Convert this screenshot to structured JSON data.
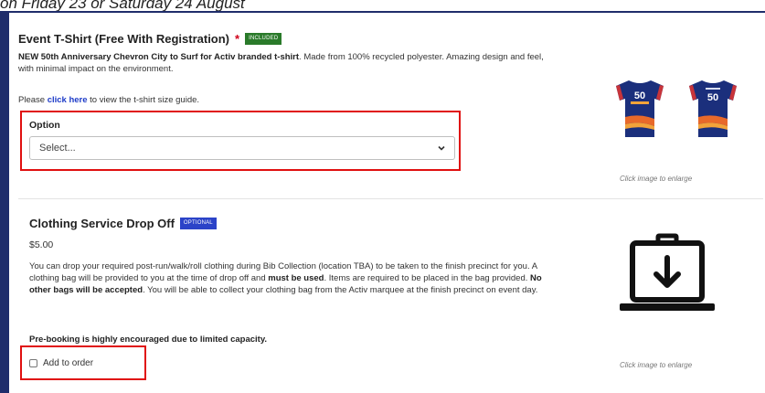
{
  "page": {
    "top_caption": "on Friday 23 or Saturday 24 August"
  },
  "tshirt": {
    "title": "Event T-Shirt (Free With Registration)",
    "required_marker": "*",
    "badge": "INCLUDED",
    "desc_bold": "NEW 50th Anniversary Chevron City to Surf for Activ branded t-shirt",
    "desc_rest": ". Made from 100% recycled polyester. Amazing design and feel, with minimal impact on the environment.",
    "guide_prefix": "Please ",
    "guide_link": "click here",
    "guide_suffix": " to view the t-shirt size guide.",
    "option_label": "Option",
    "select_value": "Select...",
    "enlarge_text": "Click image to enlarge",
    "shirt_mark": "50"
  },
  "clothing": {
    "title": "Clothing Service Drop Off",
    "badge": "OPTIONAL",
    "price": "$5.00",
    "desc_1": "You can drop your required post-run/walk/roll clothing during Bib Collection (location TBA) to be taken to the finish precinct for you. A clothing bag will be provided to you at the time of drop off and ",
    "desc_bold_1": "must be used",
    "desc_2": ". Items are required to be placed in the bag provided. ",
    "desc_bold_2": "No other bags will be accepted",
    "desc_3": ". You will be able to collect your clothing bag from the Activ marquee at the finish precinct on event day.",
    "prebook_note": "Pre-booking is highly encouraged due to limited capacity.",
    "checkbox_label": "Add to order",
    "enlarge_text": "Click image to enlarge"
  },
  "colors": {
    "frame": "#1f2d6b",
    "highlight": "#e01010",
    "link": "#1e3cc8",
    "badge_included": "#2a7a2a",
    "badge_optional": "#2b43c8"
  }
}
